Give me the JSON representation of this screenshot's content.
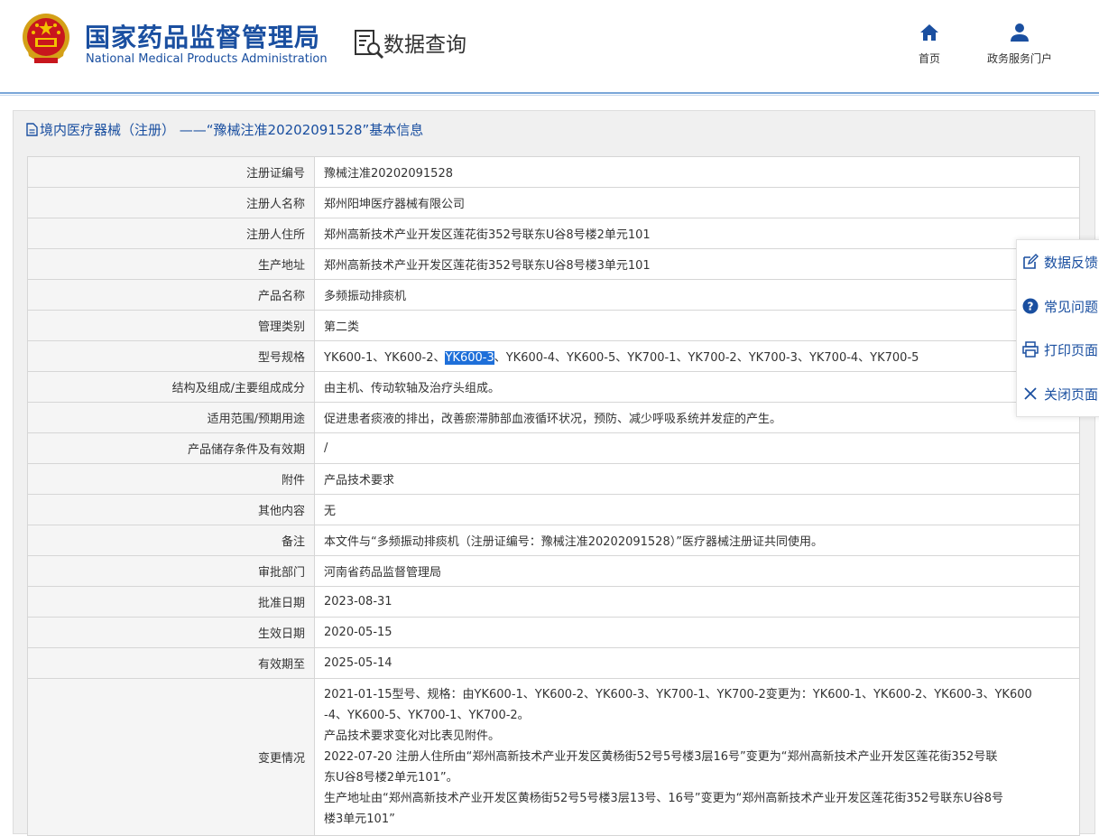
{
  "header": {
    "org_name_cn": "国家药品监督管理局",
    "org_name_en": "National Medical Products Administration",
    "section_label": "数据查询",
    "nav": {
      "home_label": "首页",
      "service_label": "政务服务门户"
    }
  },
  "panel": {
    "title": "境内医疗器械（注册） ——“豫械注准20202091528”基本信息"
  },
  "rows": [
    {
      "label": "注册证编号",
      "value": "豫械注准20202091528"
    },
    {
      "label": "注册人名称",
      "value": "郑州阳坤医疗器械有限公司"
    },
    {
      "label": "注册人住所",
      "value": "郑州高新技术产业开发区莲花街352号联东U谷8号楼2单元101"
    },
    {
      "label": "生产地址",
      "value": "郑州高新技术产业开发区莲花街352号联东U谷8号楼3单元101"
    },
    {
      "label": "产品名称",
      "value": "多频振动排痰机"
    },
    {
      "label": "管理类别",
      "value": "第二类"
    },
    {
      "label": "型号规格",
      "value_before": "YK600-1、YK600-2、",
      "value_selected": "YK600-3",
      "value_after": "、YK600-4、YK600-5、YK700-1、YK700-2、YK700-3、YK700-4、YK700-5"
    },
    {
      "label": "结构及组成/主要组成成分",
      "value": "由主机、传动软轴及治疗头组成。"
    },
    {
      "label": "适用范围/预期用途",
      "value": "促进患者痰液的排出，改善瘀滞肺部血液循环状况，预防、减少呼吸系统并发症的产生。"
    },
    {
      "label": "产品储存条件及有效期",
      "value": "/"
    },
    {
      "label": "附件",
      "value": "产品技术要求"
    },
    {
      "label": "其他内容",
      "value": "无"
    },
    {
      "label": "备注",
      "value": "本文件与“多频振动排痰机（注册证编号：豫械注准20202091528）”医疗器械注册证共同使用。"
    },
    {
      "label": "审批部门",
      "value": "河南省药品监督管理局"
    },
    {
      "label": "批准日期",
      "value": "2023-08-31"
    },
    {
      "label": "生效日期",
      "value": "2020-05-15"
    },
    {
      "label": "有效期至",
      "value": "2025-05-14"
    }
  ],
  "changes": {
    "label": "变更情况",
    "lines": [
      "2021-01-15型号、规格：由YK600-1、YK600-2、YK600-3、YK700-1、YK700-2变更为：YK600-1、YK600-2、YK600-3、YK600",
      "-4、YK600-5、YK700-1、YK700-2。",
      "产品技术要求变化对比表见附件。",
      "2022-07-20 注册人住所由“郑州高新技术产业开发区黄杨街52号5号楼3层16号”变更为“郑州高新技术产业开发区莲花街352号联",
      "东U谷8号楼2单元101”。",
      "生产地址由“郑州高新技术产业开发区黄杨街52号5号楼3层13号、16号”变更为“郑州高新技术产业开发区莲花街352号联东U谷8号",
      "楼3单元101”"
    ]
  },
  "side_tools": {
    "feedback": "数据反馈",
    "faq": "常见问题",
    "print": "打印页面",
    "close": "关闭页面"
  },
  "colors": {
    "brand_blue": "#1a4fa0",
    "selection": "#1e6fd9"
  }
}
